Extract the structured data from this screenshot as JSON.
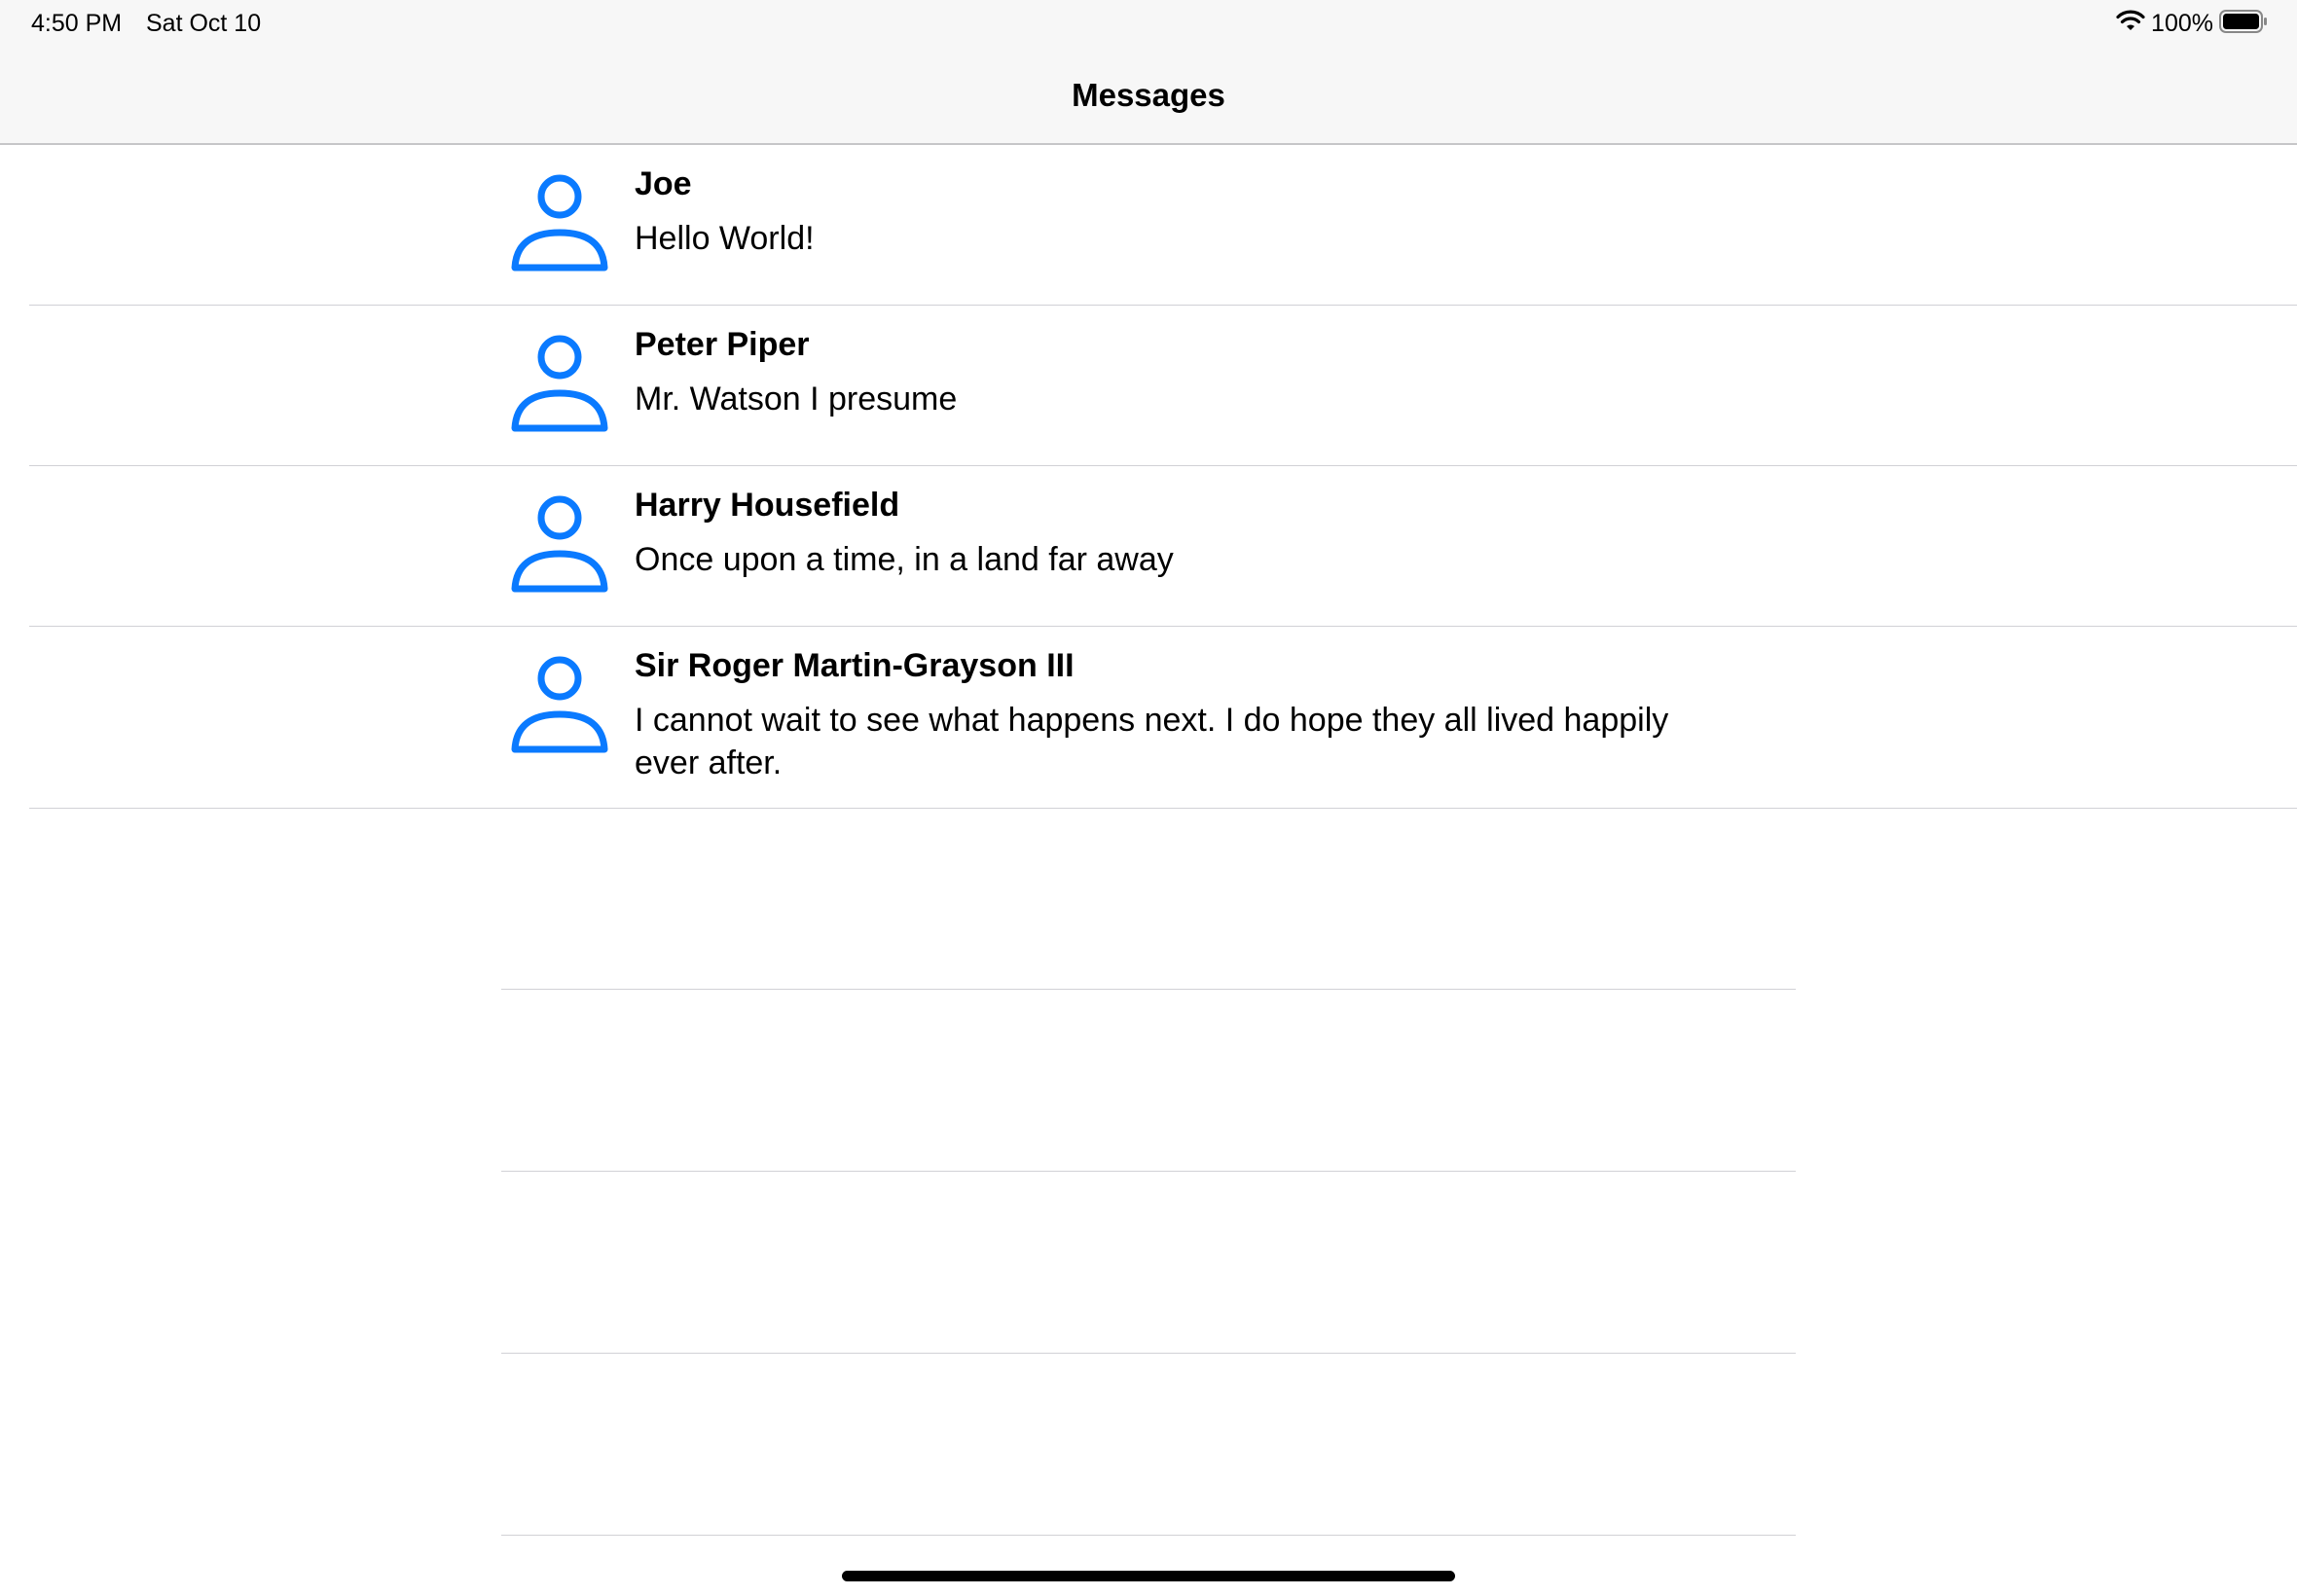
{
  "status_bar": {
    "time": "4:50 PM",
    "date": "Sat Oct 10",
    "battery_percent": "100%",
    "battery_level": 1.0,
    "wifi_icon": "wifi-icon",
    "battery_icon": "battery-full-icon"
  },
  "nav": {
    "title": "Messages"
  },
  "colors": {
    "accent": "#0a7aff",
    "separator": "#d1d1d6",
    "nav_background": "#f7f7f7"
  },
  "messages": [
    {
      "sender": "Joe",
      "preview": "Hello World!",
      "avatar_icon": "person-icon"
    },
    {
      "sender": "Peter Piper",
      "preview": "Mr. Watson I presume",
      "avatar_icon": "person-icon"
    },
    {
      "sender": "Harry Housefield",
      "preview": "Once upon a time, in a land far away",
      "avatar_icon": "person-icon"
    },
    {
      "sender": "Sir Roger Martin-Grayson III",
      "preview": "I cannot wait to see what happens next. I do hope they all lived happily ever after.",
      "avatar_icon": "person-icon"
    }
  ]
}
